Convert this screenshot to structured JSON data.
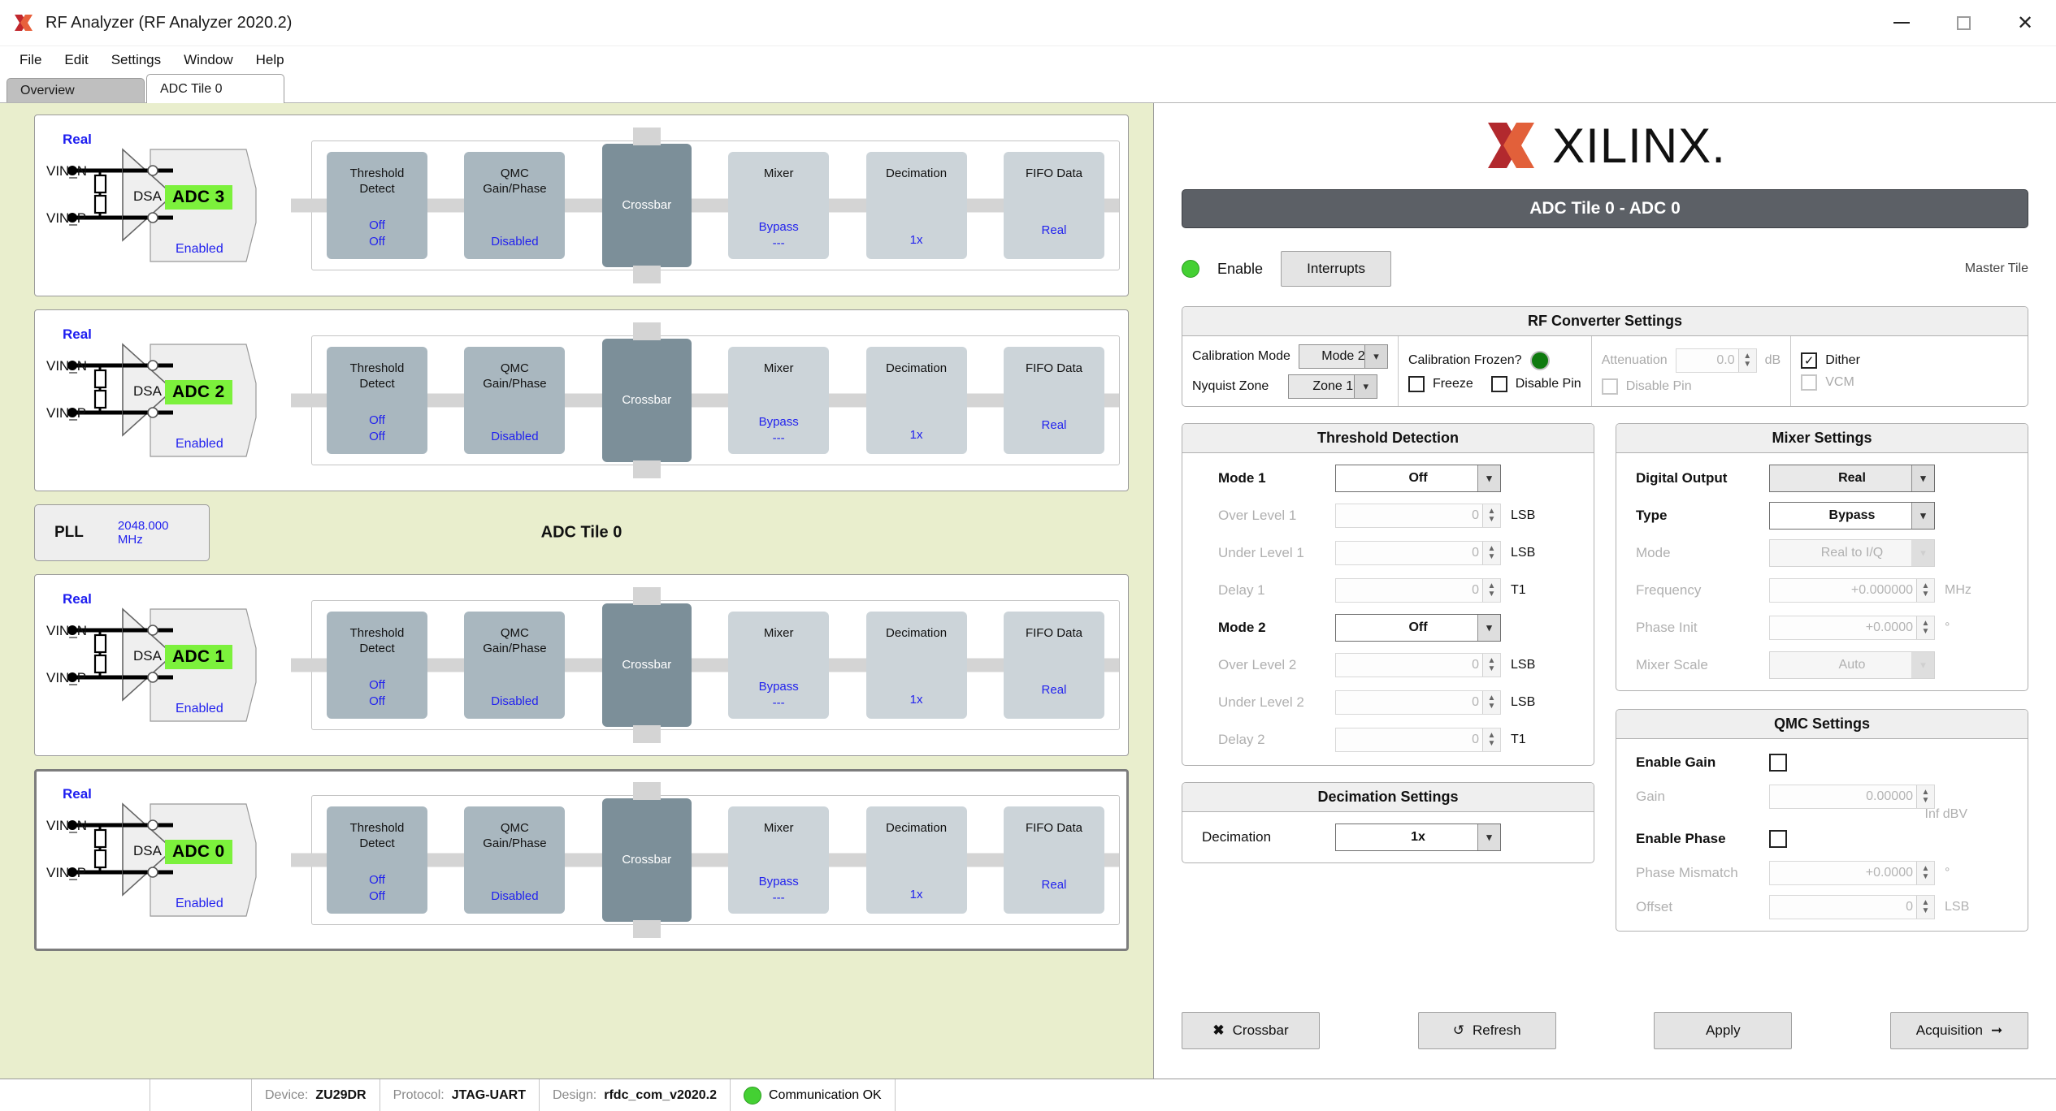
{
  "window": {
    "title": "RF Analyzer (RF Analyzer 2020.2)",
    "minimize_label": "minimize",
    "maximize_label": "maximize",
    "close_label": "✕"
  },
  "menu": {
    "items": [
      "File",
      "Edit",
      "Settings",
      "Window",
      "Help"
    ]
  },
  "tabs": [
    {
      "label": "Overview",
      "active": false
    },
    {
      "label": "ADC Tile 0",
      "active": true
    }
  ],
  "diagram": {
    "tile_name": "ADC Tile 0",
    "pll": {
      "label": "PLL",
      "value": "2048.000 MHz"
    },
    "input_labels": {
      "n": "VIN_N",
      "p": "VIN_P",
      "dsa": "DSA"
    },
    "adcs": [
      {
        "mode": "Real",
        "name": "ADC 3",
        "state": "Enabled",
        "selected": false,
        "blocks": [
          {
            "title": "Threshold\nDetect",
            "value": "Off\nOff",
            "style": "mid"
          },
          {
            "title": "QMC\nGain/Phase",
            "value": "Disabled",
            "style": "mid"
          },
          {
            "title": "Crossbar",
            "value": "",
            "style": "xbar"
          },
          {
            "title": "Mixer",
            "value": "Bypass\n---",
            "style": "light"
          },
          {
            "title": "Decimation",
            "value": "1x",
            "style": "light"
          },
          {
            "title": "FIFO Data",
            "value": "Real",
            "style": "light"
          }
        ]
      },
      {
        "mode": "Real",
        "name": "ADC 2",
        "state": "Enabled",
        "selected": false,
        "blocks": [
          {
            "title": "Threshold\nDetect",
            "value": "Off\nOff",
            "style": "mid"
          },
          {
            "title": "QMC\nGain/Phase",
            "value": "Disabled",
            "style": "mid"
          },
          {
            "title": "Crossbar",
            "value": "",
            "style": "xbar"
          },
          {
            "title": "Mixer",
            "value": "Bypass\n---",
            "style": "light"
          },
          {
            "title": "Decimation",
            "value": "1x",
            "style": "light"
          },
          {
            "title": "FIFO Data",
            "value": "Real",
            "style": "light"
          }
        ]
      },
      {
        "mode": "Real",
        "name": "ADC 1",
        "state": "Enabled",
        "selected": false,
        "blocks": [
          {
            "title": "Threshold\nDetect",
            "value": "Off\nOff",
            "style": "mid"
          },
          {
            "title": "QMC\nGain/Phase",
            "value": "Disabled",
            "style": "mid"
          },
          {
            "title": "Crossbar",
            "value": "",
            "style": "xbar"
          },
          {
            "title": "Mixer",
            "value": "Bypass\n---",
            "style": "light"
          },
          {
            "title": "Decimation",
            "value": "1x",
            "style": "light"
          },
          {
            "title": "FIFO Data",
            "value": "Real",
            "style": "light"
          }
        ]
      },
      {
        "mode": "Real",
        "name": "ADC 0",
        "state": "Enabled",
        "selected": true,
        "blocks": [
          {
            "title": "Threshold\nDetect",
            "value": "Off\nOff",
            "style": "mid"
          },
          {
            "title": "QMC\nGain/Phase",
            "value": "Disabled",
            "style": "mid"
          },
          {
            "title": "Crossbar",
            "value": "",
            "style": "xbar"
          },
          {
            "title": "Mixer",
            "value": "Bypass\n---",
            "style": "light"
          },
          {
            "title": "Decimation",
            "value": "1x",
            "style": "light"
          },
          {
            "title": "FIFO Data",
            "value": "Real",
            "style": "light"
          }
        ]
      }
    ]
  },
  "panel": {
    "brand": "XILINX.",
    "header": "ADC Tile 0 - ADC 0",
    "enable_label": "Enable",
    "interrupts_label": "Interrupts",
    "master_tile_label": "Master Tile",
    "rf_converter": {
      "title": "RF Converter Settings",
      "calibration_mode_label": "Calibration Mode",
      "calibration_mode_value": "Mode 2",
      "nyquist_zone_label": "Nyquist Zone",
      "nyquist_zone_value": "Zone 1",
      "calibration_frozen_label": "Calibration Frozen?",
      "freeze_label": "Freeze",
      "freeze_checked": false,
      "disable_pin_label": "Disable Pin",
      "disable_pin_checked": false,
      "attenuation_label": "Attenuation",
      "attenuation_value": "0.0",
      "attenuation_unit": "dB",
      "attenuation_disable_pin_label": "Disable Pin",
      "dither_label": "Dither",
      "dither_checked": true,
      "vcm_label": "VCM",
      "vcm_checked": false
    },
    "threshold": {
      "title": "Threshold Detection",
      "rows": [
        {
          "label": "Mode 1",
          "value": "Off",
          "unit": "",
          "kind": "select",
          "bold": true,
          "dim": false
        },
        {
          "label": "Over Level 1",
          "value": "0",
          "unit": "LSB",
          "kind": "spin",
          "bold": false,
          "dim": true
        },
        {
          "label": "Under Level 1",
          "value": "0",
          "unit": "LSB",
          "kind": "spin",
          "bold": false,
          "dim": true
        },
        {
          "label": "Delay 1",
          "value": "0",
          "unit": "T1",
          "kind": "spin",
          "bold": false,
          "dim": true
        },
        {
          "label": "Mode 2",
          "value": "Off",
          "unit": "",
          "kind": "select",
          "bold": true,
          "dim": false
        },
        {
          "label": "Over Level 2",
          "value": "0",
          "unit": "LSB",
          "kind": "spin",
          "bold": false,
          "dim": true
        },
        {
          "label": "Under Level 2",
          "value": "0",
          "unit": "LSB",
          "kind": "spin",
          "bold": false,
          "dim": true
        },
        {
          "label": "Delay 2",
          "value": "0",
          "unit": "T1",
          "kind": "spin",
          "bold": false,
          "dim": true
        }
      ]
    },
    "decimation": {
      "title": "Decimation Settings",
      "label": "Decimation",
      "value": "1x"
    },
    "mixer": {
      "title": "Mixer Settings",
      "rows": [
        {
          "label": "Digital Output",
          "value": "Real",
          "unit": "",
          "kind": "select",
          "bold": true,
          "dim": false
        },
        {
          "label": "Type",
          "value": "Bypass",
          "unit": "",
          "kind": "select",
          "bold": true,
          "dim": false
        },
        {
          "label": "Mode",
          "value": "Real to I/Q",
          "unit": "",
          "kind": "select",
          "bold": false,
          "dim": true
        },
        {
          "label": "Frequency",
          "value": "+0.000000",
          "unit": "MHz",
          "kind": "spin",
          "bold": false,
          "dim": true
        },
        {
          "label": "Phase Init",
          "value": "+0.0000",
          "unit": "°",
          "kind": "spin",
          "bold": false,
          "dim": true
        },
        {
          "label": "Mixer Scale",
          "value": "Auto",
          "unit": "",
          "kind": "select",
          "bold": false,
          "dim": true
        }
      ]
    },
    "qmc": {
      "title": "QMC Settings",
      "enable_gain_label": "Enable Gain",
      "enable_gain_checked": false,
      "gain_label": "Gain",
      "gain_value": "0.00000",
      "gain_note": "Inf dBV",
      "enable_phase_label": "Enable Phase",
      "enable_phase_checked": false,
      "phase_mismatch_label": "Phase Mismatch",
      "phase_mismatch_value": "+0.0000",
      "phase_unit": "°",
      "offset_label": "Offset",
      "offset_value": "0",
      "offset_unit": "LSB"
    },
    "buttons": {
      "crossbar": "Crossbar",
      "refresh": "Refresh",
      "apply": "Apply",
      "acquisition": "Acquisition"
    }
  },
  "status": {
    "device_key": "Device:",
    "device_value": "ZU29DR",
    "protocol_key": "Protocol:",
    "protocol_value": "JTAG-UART",
    "design_key": "Design:",
    "design_value": "rfdc_com_v2020.2",
    "comm_text": "Communication OK"
  },
  "colors": {
    "canvas_green": "#e9eecd",
    "adc_green": "#7cf13c",
    "blue_text": "#2222ee",
    "header_dark": "#5c6066",
    "block_mid": "#a9b7bf",
    "block_light": "#ccd4d9",
    "block_xbar": "#7c8f99"
  }
}
